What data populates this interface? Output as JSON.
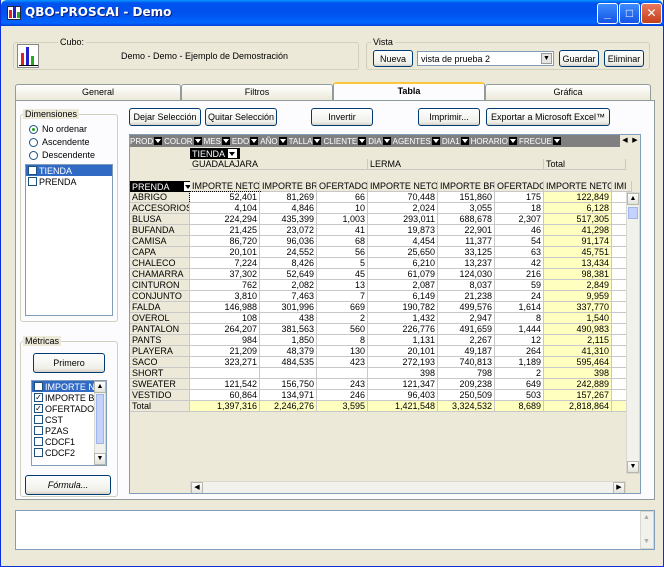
{
  "window": {
    "title": "QBO-PROSCAI - Demo"
  },
  "cubo": {
    "label": "Cubo:",
    "value": "Demo - Demo - Ejemplo de Demostración"
  },
  "vista": {
    "label": "Vista",
    "nueva": "Nueva",
    "selected": "vista de prueba 2",
    "guardar": "Guardar",
    "eliminar": "Eliminar"
  },
  "tabs": [
    {
      "label": "General"
    },
    {
      "label": "Filtros"
    },
    {
      "label": "Tabla"
    },
    {
      "label": "Gráfica"
    }
  ],
  "dimensiones": {
    "label": "Dimensiones",
    "options": [
      "No ordenar",
      "Ascendente",
      "Descendente"
    ],
    "items": [
      "TIENDA",
      "PRENDA"
    ]
  },
  "metricas": {
    "label": "Métricas",
    "primero": "Primero",
    "items": [
      {
        "label": "IMPORTE NE",
        "checked": true
      },
      {
        "label": "IMPORTE BR",
        "checked": true
      },
      {
        "label": "OFERTADO",
        "checked": true
      },
      {
        "label": "CST",
        "checked": false
      },
      {
        "label": "PZAS",
        "checked": false
      },
      {
        "label": "CDCF1",
        "checked": false
      },
      {
        "label": "CDCF2",
        "checked": false
      }
    ],
    "formula": "Fórmula..."
  },
  "toolbar": {
    "dejar": "Dejar Selección",
    "quitar": "Quitar Selección",
    "invertir": "Invertir",
    "imprimir": "Imprimir...",
    "exportar": "Exportar a Microsoft Excel™"
  },
  "dim_bar": [
    "PROD",
    "COLOR",
    "MES",
    "EDO",
    "AÑO",
    "TALLA",
    "CLIENTE",
    "DIA",
    "AGENTES",
    "DIA1",
    "HORARIO",
    "FRECUE"
  ],
  "table": {
    "col_dim": "TIENDA",
    "row_dim": "PRENDA",
    "groups": [
      "GUADALAJARA",
      "LERMA",
      "Total"
    ],
    "metrics": [
      "IMPORTE NETO",
      "IMPORTE BR",
      "OFERTADO",
      "IMPORTE NETO",
      "IMPORTE BR",
      "OFERTADO",
      "IMPORTE NETO",
      "IMI"
    ],
    "rows": [
      {
        "label": "ABRIGO",
        "values": [
          "52,401",
          "81,269",
          "66",
          "70,448",
          "151,860",
          "175",
          "122,849"
        ]
      },
      {
        "label": "ACCESORIOS",
        "values": [
          "4,104",
          "4,846",
          "10",
          "2,024",
          "3,055",
          "18",
          "6,128"
        ]
      },
      {
        "label": "BLUSA",
        "values": [
          "224,294",
          "435,399",
          "1,003",
          "293,011",
          "688,678",
          "2,307",
          "517,305"
        ]
      },
      {
        "label": "BUFANDA",
        "values": [
          "21,425",
          "23,072",
          "41",
          "19,873",
          "22,901",
          "46",
          "41,298"
        ]
      },
      {
        "label": "CAMISA",
        "values": [
          "86,720",
          "96,036",
          "68",
          "4,454",
          "11,377",
          "54",
          "91,174"
        ]
      },
      {
        "label": "CAPA",
        "values": [
          "20,101",
          "24,552",
          "56",
          "25,650",
          "33,125",
          "63",
          "45,751"
        ]
      },
      {
        "label": "CHALECO",
        "values": [
          "7,224",
          "8,426",
          "5",
          "6,210",
          "13,237",
          "42",
          "13,434"
        ]
      },
      {
        "label": "CHAMARRA",
        "values": [
          "37,302",
          "52,649",
          "45",
          "61,079",
          "124,030",
          "216",
          "98,381"
        ]
      },
      {
        "label": "CINTURON",
        "values": [
          "762",
          "2,082",
          "13",
          "2,087",
          "8,037",
          "59",
          "2,849"
        ]
      },
      {
        "label": "CONJUNTO",
        "values": [
          "3,810",
          "7,463",
          "7",
          "6,149",
          "21,238",
          "24",
          "9,959"
        ]
      },
      {
        "label": "FALDA",
        "values": [
          "146,988",
          "301,996",
          "669",
          "190,782",
          "499,576",
          "1,614",
          "337,770"
        ]
      },
      {
        "label": "OVEROL",
        "values": [
          "108",
          "438",
          "2",
          "1,432",
          "2,947",
          "8",
          "1,540"
        ]
      },
      {
        "label": "PANTALON",
        "values": [
          "264,207",
          "381,563",
          "560",
          "226,776",
          "491,659",
          "1,444",
          "490,983"
        ]
      },
      {
        "label": "PANTS",
        "values": [
          "984",
          "1,850",
          "8",
          "1,131",
          "2,267",
          "12",
          "2,115"
        ]
      },
      {
        "label": "PLAYERA",
        "values": [
          "21,209",
          "48,379",
          "130",
          "20,101",
          "49,187",
          "264",
          "41,310"
        ]
      },
      {
        "label": "SACO",
        "values": [
          "323,271",
          "484,535",
          "423",
          "272,193",
          "740,813",
          "1,189",
          "595,464"
        ]
      },
      {
        "label": "SHORT",
        "values": [
          "",
          "",
          "",
          "398",
          "798",
          "2",
          "398"
        ]
      },
      {
        "label": "SWEATER",
        "values": [
          "121,542",
          "156,750",
          "243",
          "121,347",
          "209,238",
          "649",
          "242,889"
        ]
      },
      {
        "label": "VESTIDO",
        "values": [
          "60,864",
          "134,971",
          "246",
          "96,403",
          "250,509",
          "503",
          "157,267"
        ]
      },
      {
        "label": "Total",
        "values": [
          "1,397,316",
          "2,246,276",
          "3,595",
          "1,421,548",
          "3,324,532",
          "8,689",
          "2,818,864"
        ]
      }
    ]
  },
  "colors": {
    "title_blue": "#0053ee",
    "total_yellow": "#ffffc0",
    "selection": "#316ac5"
  }
}
